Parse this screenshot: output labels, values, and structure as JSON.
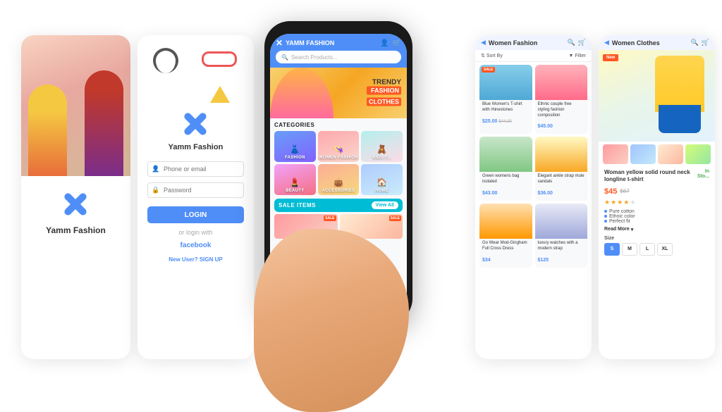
{
  "app": {
    "name": "Yamm Fashion",
    "tagline": "TRENDY FASHION CLOTHES",
    "search_placeholder": "Search Products..."
  },
  "splash": {
    "logo_text": "Yamm Fashion"
  },
  "login": {
    "logo_text": "Yamm Fashion",
    "phone_placeholder": "Phone or email",
    "password_placeholder": "Password",
    "login_btn": "LOGIN",
    "or_text": "or login with",
    "facebook_text": "facebook",
    "signup_text": "New User?",
    "signup_link": "SIGN UP"
  },
  "phone": {
    "header_title": "YAMM FASHION",
    "search_placeholder": "Search Products...",
    "banner": {
      "line1": "TRENDY",
      "line2": "FASHION",
      "line3": "CLOTHES"
    },
    "categories_title": "CATEGORIES",
    "categories": [
      {
        "label": "Fashion",
        "icon": "👗"
      },
      {
        "label": "WOMEN FASHION",
        "icon": "👒"
      },
      {
        "label": "KIDS F...",
        "icon": "🧸"
      },
      {
        "label": "BEAUTY",
        "icon": "💄"
      },
      {
        "label": "ACCESSORIES",
        "icon": "👜"
      },
      {
        "label": "HOME",
        "icon": "🏠"
      }
    ],
    "sale_title": "SALE ITEMS",
    "view_all": "View All"
  },
  "women_fashion": {
    "title": "Women Fashion",
    "sort_label": "Sort By",
    "filter_label": "Filter",
    "products": [
      {
        "name": "Blue Women's T-shirt with rhinestones",
        "price": "$25.00",
        "old_price": "$44.00",
        "badge": "SALE",
        "img": "dress1"
      },
      {
        "name": "Ethnic couple free styling fashion composition",
        "price": "$45.00",
        "img": "dress2"
      },
      {
        "name": "Green womens bag isolated",
        "price": "$43.00",
        "img": "bag"
      },
      {
        "name": "Elegant ankle strap mule sandals low kitten pan",
        "price": "$36.00",
        "img": "shoes"
      },
      {
        "name": "Go Wear Mod-Gingham Full Cross Dress",
        "price": "$34",
        "img": "watch"
      },
      {
        "name": "luxury watches with a modern strap",
        "price": "$125",
        "img": "glasses"
      }
    ]
  },
  "women_clothes": {
    "title": "Women Clothes",
    "badge": "New",
    "product_name": "Woman yellow solid round neck longline t-shirt",
    "in_stock": "In Sto...",
    "price": "$45",
    "old_price": "$67",
    "stars": 4,
    "max_stars": 5,
    "features": [
      "Pure cotton",
      "Ethnic color",
      "Perfect fit"
    ],
    "read_more": "Read More",
    "size_label": "Size",
    "sizes": [
      "S",
      "M",
      "L",
      "XL"
    ],
    "active_size": "S",
    "thumbnails": [
      "thumb-1",
      "thumb-2",
      "thumb-3",
      "thumb-4"
    ]
  }
}
